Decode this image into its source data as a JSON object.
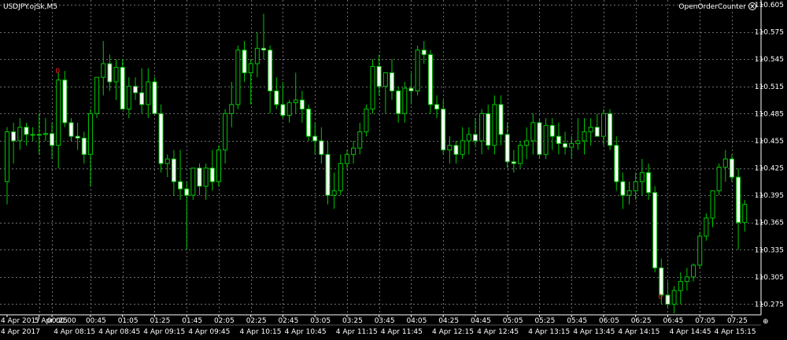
{
  "header": {
    "symbol_title": "USDJPY.ojSk,M5",
    "indicator_name": "OpenOrderCounter",
    "close_icon": "circle-x-icon"
  },
  "colors": {
    "background": "#000000",
    "grid": "#6e6e6e",
    "bull_body": "#000000",
    "bull_outline": "#00c800",
    "bear_body": "#ffffff",
    "bear_outline": "#00c800",
    "wick": "#00c800",
    "axis_text": "#ffffff",
    "marker": "#ff2020"
  },
  "chart_data": {
    "type": "candlestick",
    "title": "USDJPY.ojSk,M5",
    "ylim": [
      110.265,
      110.605
    ],
    "yticks": [
      110.605,
      110.575,
      110.545,
      110.515,
      110.485,
      110.455,
      110.425,
      110.395,
      110.365,
      110.335,
      110.305,
      110.275
    ],
    "x_upper_labels": [
      {
        "i": 0,
        "text": "4 Apr 2017"
      },
      {
        "i": 5,
        "text": "5 Apr 00:00"
      },
      {
        "i": 7,
        "text": "00:25"
      },
      {
        "i": 13,
        "text": "00:45"
      },
      {
        "i": 18,
        "text": "01:05"
      },
      {
        "i": 23,
        "text": "01:25"
      },
      {
        "i": 28,
        "text": "01:45"
      },
      {
        "i": 33,
        "text": "02:05"
      },
      {
        "i": 38,
        "text": "02:25"
      },
      {
        "i": 43,
        "text": "02:45"
      },
      {
        "i": 48,
        "text": "03:05"
      },
      {
        "i": 53,
        "text": "03:25"
      },
      {
        "i": 58,
        "text": "03:45"
      },
      {
        "i": 63,
        "text": "04:05"
      },
      {
        "i": 68,
        "text": "04:25"
      },
      {
        "i": 73,
        "text": "04:45"
      },
      {
        "i": 78,
        "text": "05:05"
      },
      {
        "i": 83,
        "text": "05:25"
      },
      {
        "i": 88,
        "text": "05:45"
      },
      {
        "i": 93,
        "text": "06:05"
      },
      {
        "i": 98,
        "text": "06:25"
      },
      {
        "i": 103,
        "text": "06:45"
      },
      {
        "i": 108,
        "text": "07:05"
      },
      {
        "i": 113,
        "text": "07:25"
      }
    ],
    "x_lower_labels": [
      {
        "i": 0,
        "text": "4 Apr 2017"
      },
      {
        "i": 8,
        "text": "4 Apr 08:15"
      },
      {
        "i": 15,
        "text": "4 Apr 08:45"
      },
      {
        "i": 22,
        "text": "4 Apr 09:15"
      },
      {
        "i": 29,
        "text": "4 Apr 09:45"
      },
      {
        "i": 37,
        "text": "4 Apr 10:15"
      },
      {
        "i": 44,
        "text": "4 Apr 10:45"
      },
      {
        "i": 52,
        "text": "4 Apr 11:15"
      },
      {
        "i": 59,
        "text": "4 Apr 11:45"
      },
      {
        "i": 67,
        "text": "4 Apr 12:15"
      },
      {
        "i": 74,
        "text": "4 Apr 12:45"
      },
      {
        "i": 82,
        "text": "4 Apr 13:15"
      },
      {
        "i": 89,
        "text": "4 Apr 13:45"
      },
      {
        "i": 96,
        "text": "4 Apr 14:15"
      },
      {
        "i": 104,
        "text": "4 Apr 14:45"
      },
      {
        "i": 111,
        "text": "4 Apr 15:15"
      }
    ],
    "markers": [
      {
        "i": 8,
        "price": 110.532,
        "text": "0"
      },
      {
        "i": 102,
        "price": 110.283,
        "text": "0"
      }
    ],
    "candles": [
      [
        110.41,
        110.47,
        110.385,
        110.465
      ],
      [
        110.465,
        110.475,
        110.43,
        110.455
      ],
      [
        110.455,
        110.48,
        110.445,
        110.47
      ],
      [
        110.47,
        110.475,
        110.45,
        110.462
      ],
      [
        110.462,
        110.47,
        110.455,
        110.462
      ],
      [
        110.462,
        110.485,
        110.44,
        110.462
      ],
      [
        110.462,
        110.48,
        110.455,
        110.463
      ],
      [
        110.463,
        110.475,
        110.435,
        110.45
      ],
      [
        110.45,
        110.53,
        110.425,
        110.522
      ],
      [
        110.522,
        110.532,
        110.47,
        110.475
      ],
      [
        110.475,
        110.48,
        110.455,
        110.46
      ],
      [
        110.46,
        110.475,
        110.445,
        110.458
      ],
      [
        110.458,
        110.465,
        110.43,
        110.44
      ],
      [
        110.44,
        110.49,
        110.405,
        110.485
      ],
      [
        110.485,
        110.52,
        110.48,
        110.525
      ],
      [
        110.525,
        110.565,
        110.505,
        110.54
      ],
      [
        110.54,
        110.55,
        110.51,
        110.52
      ],
      [
        110.52,
        110.545,
        110.5,
        110.536
      ],
      [
        110.536,
        110.545,
        110.495,
        110.49
      ],
      [
        110.49,
        110.525,
        110.48,
        110.515
      ],
      [
        110.515,
        110.525,
        110.5,
        110.508
      ],
      [
        110.508,
        110.535,
        110.485,
        110.495
      ],
      [
        110.495,
        110.535,
        110.48,
        110.52
      ],
      [
        110.52,
        110.525,
        110.485,
        110.485
      ],
      [
        110.485,
        110.495,
        110.42,
        110.43
      ],
      [
        110.43,
        110.44,
        110.415,
        110.435
      ],
      [
        110.435,
        110.445,
        110.395,
        110.41
      ],
      [
        110.41,
        110.445,
        110.39,
        110.402
      ],
      [
        110.402,
        110.41,
        110.335,
        110.395
      ],
      [
        110.395,
        110.425,
        110.39,
        110.425
      ],
      [
        110.425,
        110.43,
        110.395,
        110.405
      ],
      [
        110.405,
        110.43,
        110.39,
        110.425
      ],
      [
        110.425,
        110.445,
        110.4,
        110.41
      ],
      [
        110.41,
        110.45,
        110.405,
        110.445
      ],
      [
        110.445,
        110.49,
        110.43,
        110.485
      ],
      [
        110.485,
        110.52,
        110.47,
        110.495
      ],
      [
        110.495,
        110.56,
        110.49,
        110.555
      ],
      [
        110.555,
        110.565,
        110.52,
        110.53
      ],
      [
        110.53,
        110.545,
        110.495,
        110.54
      ],
      [
        110.54,
        110.575,
        110.525,
        110.557
      ],
      [
        110.557,
        110.595,
        110.545,
        110.555
      ],
      [
        110.555,
        110.56,
        110.485,
        110.51
      ],
      [
        110.51,
        110.525,
        110.49,
        110.495
      ],
      [
        110.495,
        110.52,
        110.48,
        110.483
      ],
      [
        110.483,
        110.5,
        110.475,
        110.497
      ],
      [
        110.497,
        110.53,
        110.485,
        110.5
      ],
      [
        110.5,
        110.51,
        110.475,
        110.49
      ],
      [
        110.49,
        110.495,
        110.455,
        110.46
      ],
      [
        110.46,
        110.475,
        110.44,
        110.455
      ],
      [
        110.455,
        110.47,
        110.43,
        110.44
      ],
      [
        110.44,
        110.455,
        110.385,
        110.395
      ],
      [
        110.395,
        110.42,
        110.38,
        110.4
      ],
      [
        110.4,
        110.44,
        110.395,
        110.43
      ],
      [
        110.43,
        110.445,
        110.425,
        110.44
      ],
      [
        110.44,
        110.455,
        110.43,
        110.447
      ],
      [
        110.447,
        110.475,
        110.44,
        110.465
      ],
      [
        110.465,
        110.495,
        110.46,
        110.49
      ],
      [
        110.49,
        110.545,
        110.485,
        110.537
      ],
      [
        110.537,
        110.55,
        110.505,
        110.515
      ],
      [
        110.515,
        110.53,
        110.485,
        110.53
      ],
      [
        110.53,
        110.545,
        110.5,
        110.51
      ],
      [
        110.51,
        110.515,
        110.475,
        110.485
      ],
      [
        110.485,
        110.52,
        110.475,
        110.513
      ],
      [
        110.513,
        110.53,
        110.495,
        110.51
      ],
      [
        110.51,
        110.56,
        110.505,
        110.555
      ],
      [
        110.555,
        110.565,
        110.54,
        110.55
      ],
      [
        110.55,
        110.555,
        110.485,
        110.495
      ],
      [
        110.495,
        110.505,
        110.48,
        110.49
      ],
      [
        110.49,
        110.5,
        110.44,
        110.445
      ],
      [
        110.445,
        110.46,
        110.43,
        110.45
      ],
      [
        110.45,
        110.455,
        110.43,
        110.44
      ],
      [
        110.44,
        110.47,
        110.435,
        110.455
      ],
      [
        110.455,
        110.47,
        110.44,
        110.462
      ],
      [
        110.462,
        110.48,
        110.45,
        110.455
      ],
      [
        110.455,
        110.49,
        110.44,
        110.485
      ],
      [
        110.485,
        110.495,
        110.445,
        110.45
      ],
      [
        110.45,
        110.505,
        110.44,
        110.495
      ],
      [
        110.495,
        110.505,
        110.45,
        110.462
      ],
      [
        110.462,
        110.475,
        110.425,
        110.432
      ],
      [
        110.432,
        110.445,
        110.42,
        110.43
      ],
      [
        110.43,
        110.455,
        110.425,
        110.45
      ],
      [
        110.45,
        110.47,
        110.435,
        110.455
      ],
      [
        110.455,
        110.485,
        110.44,
        110.475
      ],
      [
        110.475,
        110.48,
        110.435,
        110.44
      ],
      [
        110.44,
        110.48,
        110.435,
        110.472
      ],
      [
        110.472,
        110.48,
        110.445,
        110.46
      ],
      [
        110.46,
        110.475,
        110.44,
        110.452
      ],
      [
        110.452,
        110.465,
        110.44,
        110.448
      ],
      [
        110.448,
        110.46,
        110.435,
        110.452
      ],
      [
        110.452,
        110.48,
        110.445,
        110.455
      ],
      [
        110.455,
        110.48,
        110.44,
        110.465
      ],
      [
        110.465,
        110.48,
        110.45,
        110.47
      ],
      [
        110.47,
        110.485,
        110.46,
        110.46
      ],
      [
        110.46,
        110.49,
        110.45,
        110.485
      ],
      [
        110.485,
        110.49,
        110.445,
        110.45
      ],
      [
        110.45,
        110.46,
        110.4,
        110.41
      ],
      [
        110.41,
        110.42,
        110.38,
        110.395
      ],
      [
        110.395,
        110.41,
        110.385,
        110.4
      ],
      [
        110.4,
        110.42,
        110.39,
        110.41
      ],
      [
        110.41,
        110.435,
        110.395,
        110.42
      ],
      [
        110.42,
        110.43,
        110.39,
        110.398
      ],
      [
        110.398,
        110.405,
        110.31,
        110.315
      ],
      [
        110.315,
        110.325,
        110.275,
        110.285
      ],
      [
        110.285,
        110.3,
        110.27,
        110.275
      ],
      [
        110.275,
        110.295,
        110.265,
        110.29
      ],
      [
        110.29,
        110.31,
        110.275,
        110.3
      ],
      [
        110.3,
        110.315,
        110.29,
        110.305
      ],
      [
        110.305,
        110.32,
        110.3,
        110.318
      ],
      [
        110.318,
        110.355,
        110.315,
        110.35
      ],
      [
        110.35,
        110.375,
        110.345,
        110.37
      ],
      [
        110.37,
        110.4,
        110.36,
        110.4
      ],
      [
        110.4,
        110.43,
        110.395,
        110.426
      ],
      [
        110.426,
        110.445,
        110.41,
        110.435
      ],
      [
        110.435,
        110.44,
        110.41,
        110.415
      ],
      [
        110.415,
        110.425,
        110.335,
        110.365
      ],
      [
        110.365,
        110.39,
        110.355,
        110.385
      ]
    ]
  }
}
